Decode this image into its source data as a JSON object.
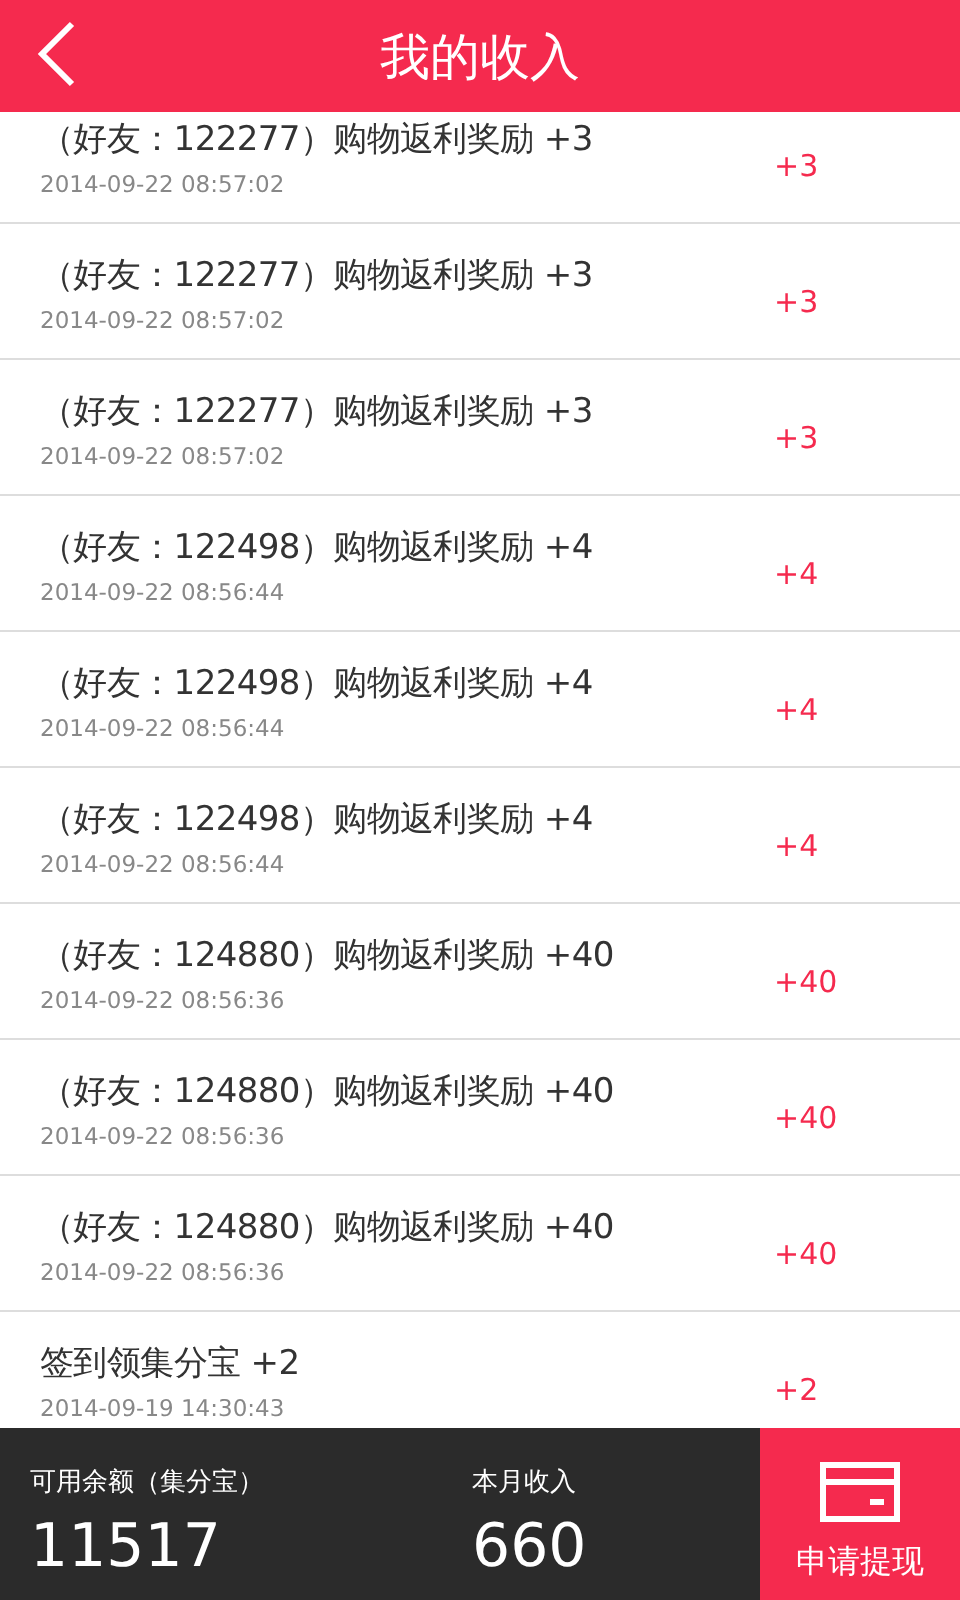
{
  "header": {
    "title": "我的收入"
  },
  "records": [
    {
      "title": "（好友：122277）购物返利奖励 +3",
      "time": "2014-09-22 08:57:02",
      "amount": "+3"
    },
    {
      "title": "（好友：122277）购物返利奖励 +3",
      "time": "2014-09-22 08:57:02",
      "amount": "+3"
    },
    {
      "title": "（好友：122277）购物返利奖励 +3",
      "time": "2014-09-22 08:57:02",
      "amount": "+3"
    },
    {
      "title": "（好友：122498）购物返利奖励 +4",
      "time": "2014-09-22 08:56:44",
      "amount": "+4"
    },
    {
      "title": "（好友：122498）购物返利奖励 +4",
      "time": "2014-09-22 08:56:44",
      "amount": "+4"
    },
    {
      "title": "（好友：122498）购物返利奖励 +4",
      "time": "2014-09-22 08:56:44",
      "amount": "+4"
    },
    {
      "title": "（好友：124880）购物返利奖励 +40",
      "time": "2014-09-22 08:56:36",
      "amount": "+40"
    },
    {
      "title": "（好友：124880）购物返利奖励 +40",
      "time": "2014-09-22 08:56:36",
      "amount": "+40"
    },
    {
      "title": "（好友：124880）购物返利奖励 +40",
      "time": "2014-09-22 08:56:36",
      "amount": "+40"
    },
    {
      "title": "签到领集分宝 +2",
      "time": "2014-09-19 14:30:43",
      "amount": "+2"
    }
  ],
  "footer": {
    "balance_label": "可用余额（集分宝）",
    "balance": "11517",
    "month_label": "本月收入",
    "month": "660",
    "withdraw": "申请提现"
  }
}
